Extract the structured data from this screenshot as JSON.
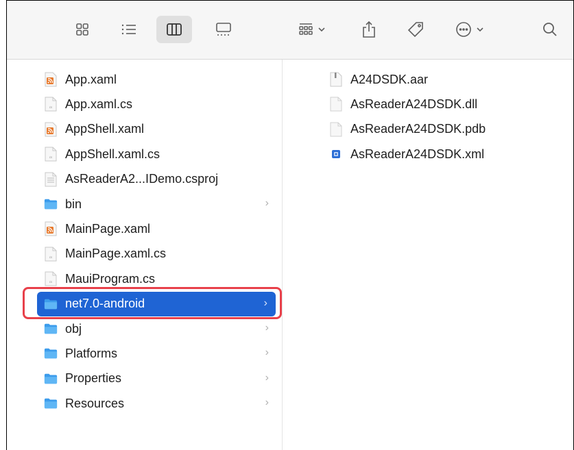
{
  "toolbar": {
    "icons": [
      "icon-view-icon",
      "list-view-icon",
      "column-view-icon",
      "gallery-view-icon",
      "group-icon",
      "share-icon",
      "tag-icon",
      "more-icon",
      "search-icon"
    ]
  },
  "column1": {
    "items": [
      {
        "label": "App.xaml",
        "icon": "rss-file-icon",
        "folder": false
      },
      {
        "label": "App.xaml.cs",
        "icon": "cs-file-icon",
        "folder": false
      },
      {
        "label": "AppShell.xaml",
        "icon": "rss-file-icon",
        "folder": false
      },
      {
        "label": "AppShell.xaml.cs",
        "icon": "cs-file-icon",
        "folder": false
      },
      {
        "label": "AsReaderA2...IDemo.csproj",
        "icon": "csproj-file-icon",
        "folder": false
      },
      {
        "label": "bin",
        "icon": "folder-icon",
        "folder": true
      },
      {
        "label": "MainPage.xaml",
        "icon": "rss-file-icon",
        "folder": false
      },
      {
        "label": "MainPage.xaml.cs",
        "icon": "cs-file-icon",
        "folder": false
      },
      {
        "label": "MauiProgram.cs",
        "icon": "cs-file-icon",
        "folder": false
      },
      {
        "label": "net7.0-android",
        "icon": "folder-icon",
        "folder": true,
        "selected": true
      },
      {
        "label": "obj",
        "icon": "folder-icon",
        "folder": true
      },
      {
        "label": "Platforms",
        "icon": "folder-icon",
        "folder": true
      },
      {
        "label": "Properties",
        "icon": "folder-icon",
        "folder": true
      },
      {
        "label": "Resources",
        "icon": "folder-icon",
        "folder": true
      }
    ]
  },
  "column2": {
    "items": [
      {
        "label": "A24DSDK.aar",
        "icon": "aar-file-icon"
      },
      {
        "label": "AsReaderA24DSDK.dll",
        "icon": "blank-file-icon"
      },
      {
        "label": "AsReaderA24DSDK.pdb",
        "icon": "blank-file-icon"
      },
      {
        "label": "AsReaderA24DSDK.xml",
        "icon": "xml-file-icon"
      }
    ]
  },
  "colors": {
    "selection": "#1f64d4",
    "highlight": "#e8404a",
    "folder": "#3c9cec",
    "rss": "#e8792c"
  }
}
